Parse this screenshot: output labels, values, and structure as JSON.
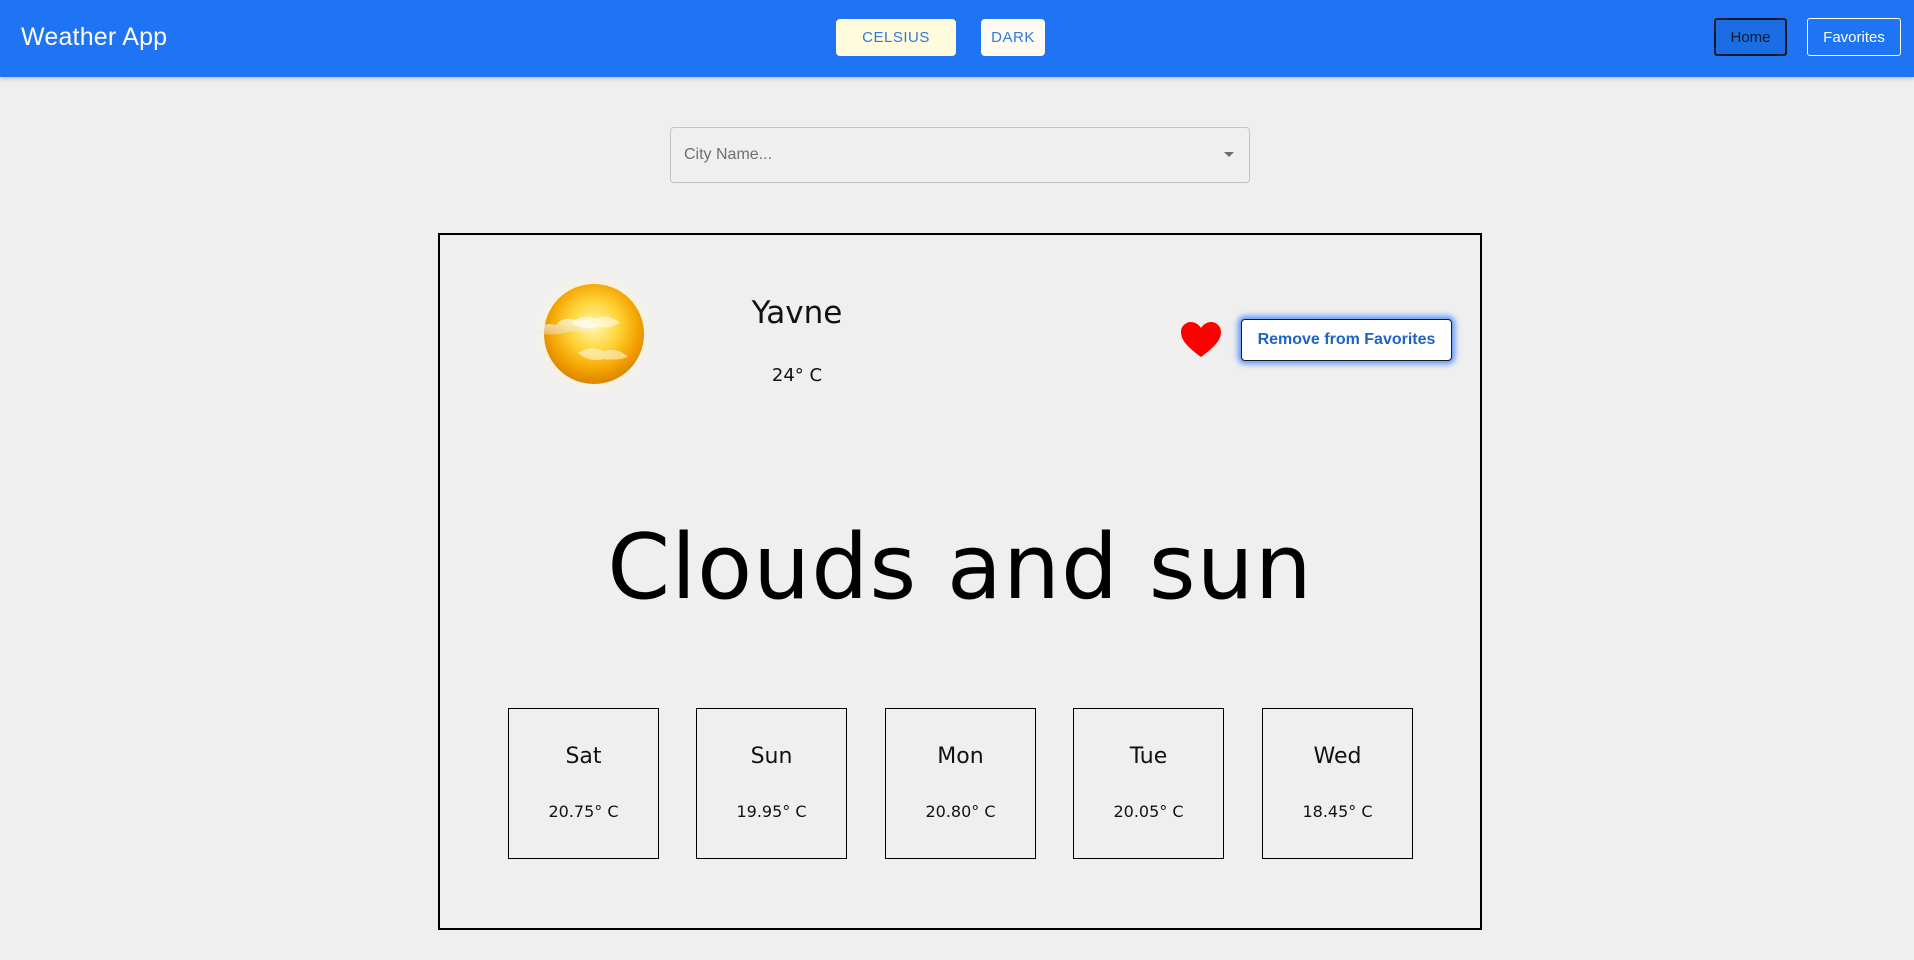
{
  "header": {
    "app_title": "Weather App",
    "units_toggle_label": "CELSIUS",
    "theme_toggle_label": "DARK",
    "nav": {
      "home_label": "Home",
      "favorites_label": "Favorites",
      "active": "Home"
    },
    "colors": {
      "bar": "#1e74f2",
      "units_button_bg": "#fffbdc"
    }
  },
  "search": {
    "placeholder": "City Name...",
    "value": ""
  },
  "current": {
    "icon": "sun-with-clouds-icon",
    "city": "Yavne",
    "temperature": "24° C",
    "favorite": true,
    "favorite_button_label": "Remove from Favorites",
    "condition": "Clouds and sun"
  },
  "forecast": [
    {
      "day": "Sat",
      "temp": "20.75° C"
    },
    {
      "day": "Sun",
      "temp": "19.95° C"
    },
    {
      "day": "Mon",
      "temp": "20.80° C"
    },
    {
      "day": "Tue",
      "temp": "20.05° C"
    },
    {
      "day": "Wed",
      "temp": "18.45° C"
    }
  ]
}
